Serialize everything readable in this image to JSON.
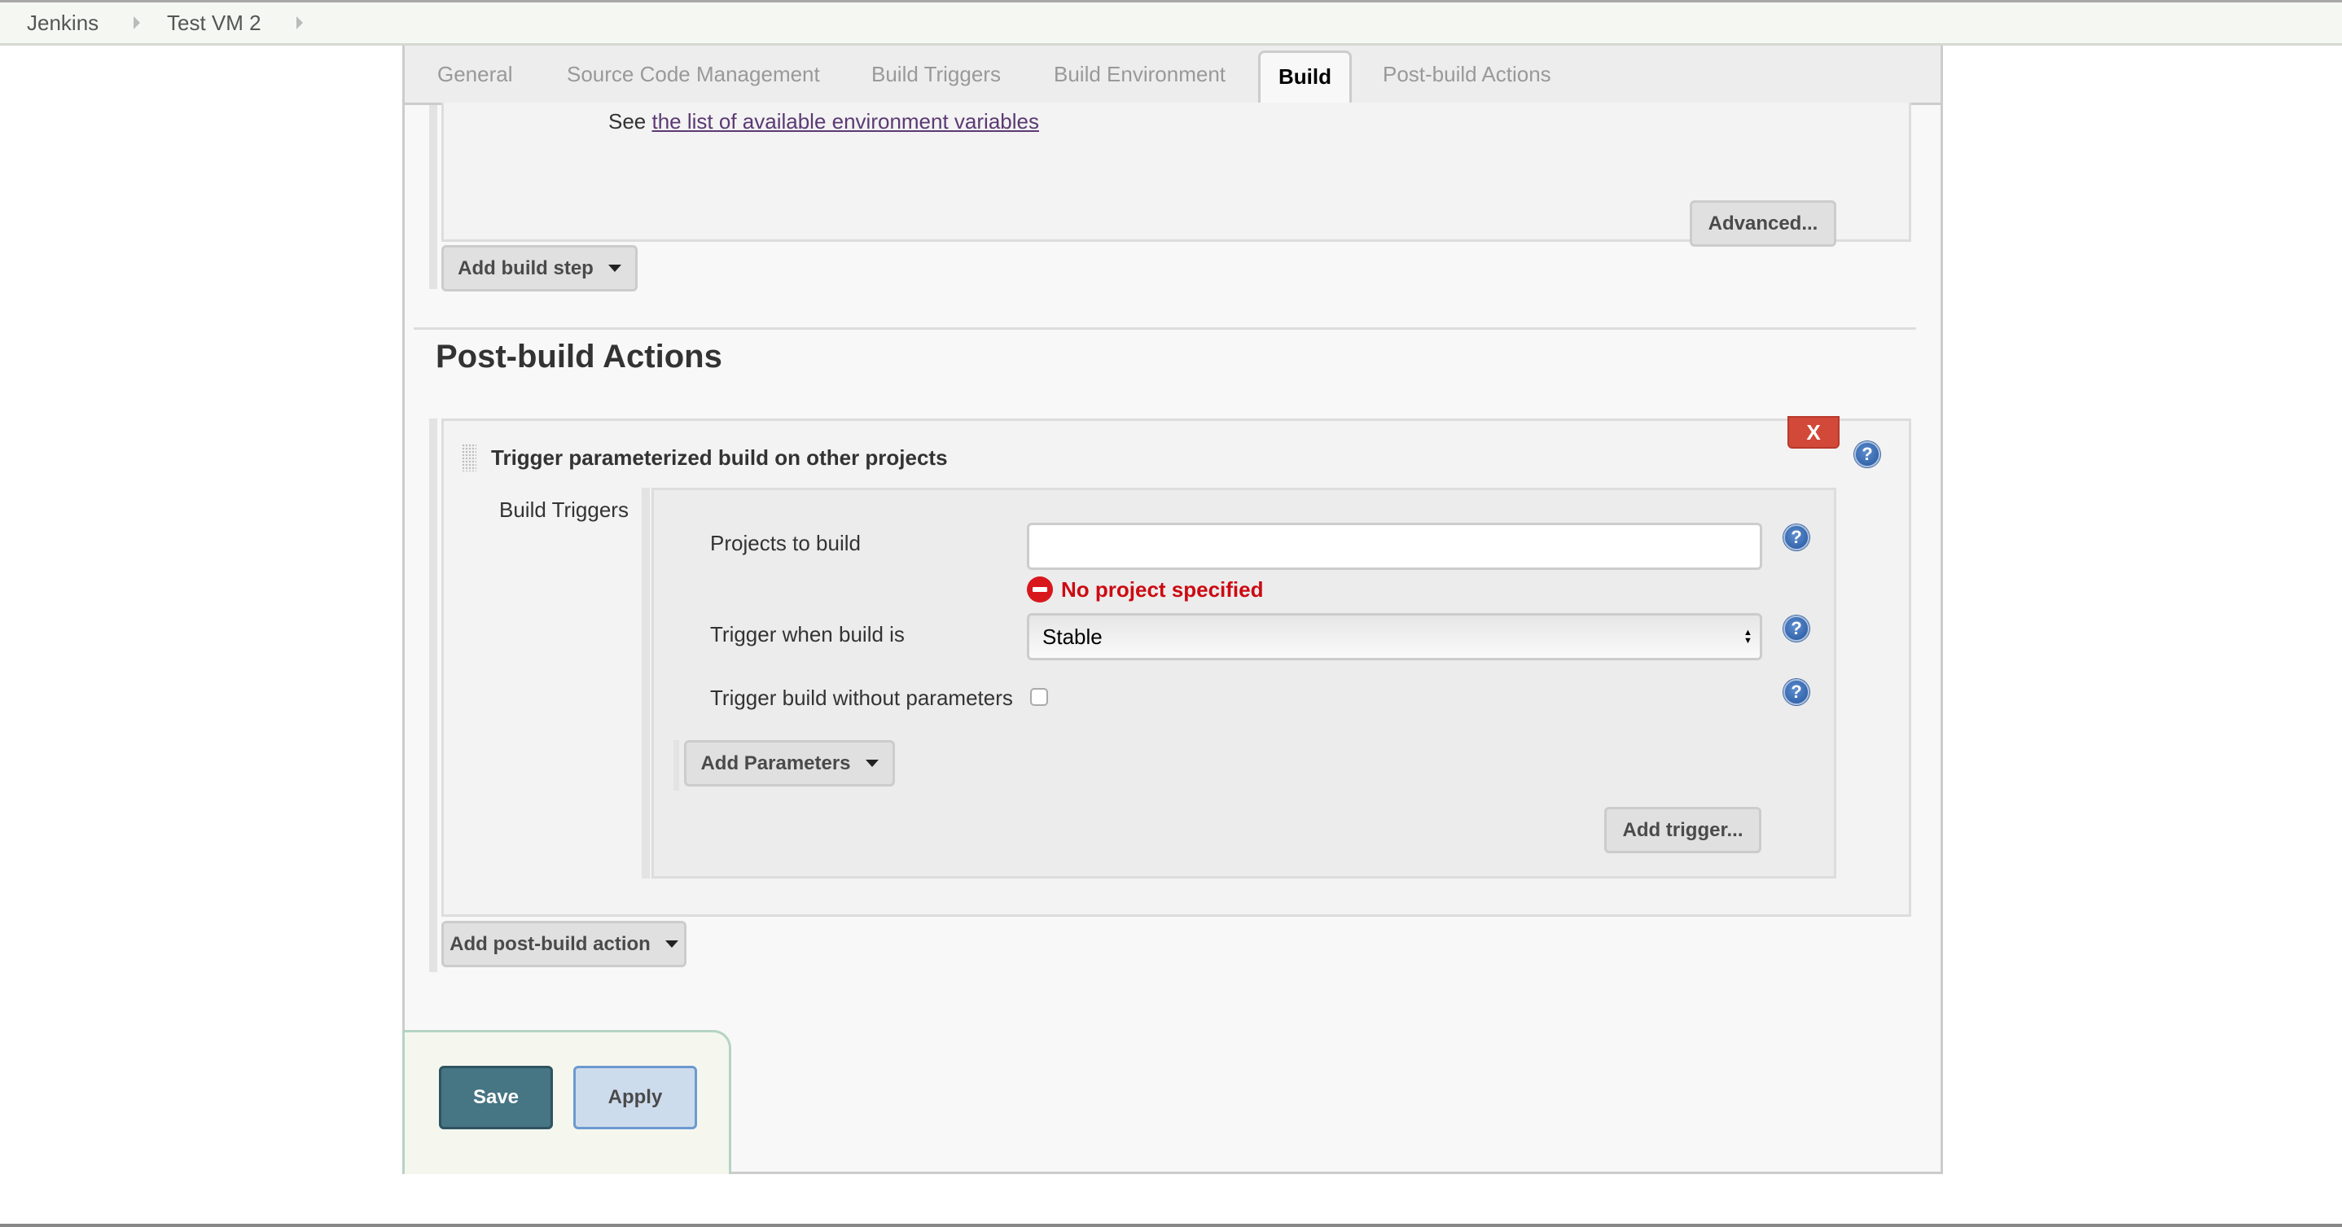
{
  "breadcrumb": {
    "items": [
      "Jenkins",
      "Test VM 2"
    ]
  },
  "tabs": [
    {
      "label": "General",
      "active": false
    },
    {
      "label": "Source Code Management",
      "active": false
    },
    {
      "label": "Build Triggers",
      "active": false
    },
    {
      "label": "Build Environment",
      "active": false
    },
    {
      "label": "Build",
      "active": true
    },
    {
      "label": "Post-build Actions",
      "active": false
    }
  ],
  "build": {
    "env_prefix": "See",
    "env_link": "the list of available environment variables",
    "advanced_label": "Advanced...",
    "add_build_step_label": "Add build step"
  },
  "post_build": {
    "heading": "Post-build Actions",
    "action": {
      "title": "Trigger parameterized build on other projects",
      "delete_label": "X",
      "section_label": "Build Triggers",
      "fields": {
        "projects_label": "Projects to build",
        "projects_value": "",
        "projects_error": "No project specified",
        "trigger_when_label": "Trigger when build is",
        "trigger_when_value": "Stable",
        "without_params_label": "Trigger build without parameters",
        "without_params_checked": false
      },
      "add_parameters_label": "Add Parameters",
      "add_trigger_label": "Add trigger..."
    },
    "add_post_build_label": "Add post-build action"
  },
  "footer": {
    "save_label": "Save",
    "apply_label": "Apply"
  },
  "colors": {
    "error": "#cc0a12",
    "delete": "#d24939",
    "save": "#467584",
    "apply": "#cddcec",
    "link": "#5b3a73"
  }
}
